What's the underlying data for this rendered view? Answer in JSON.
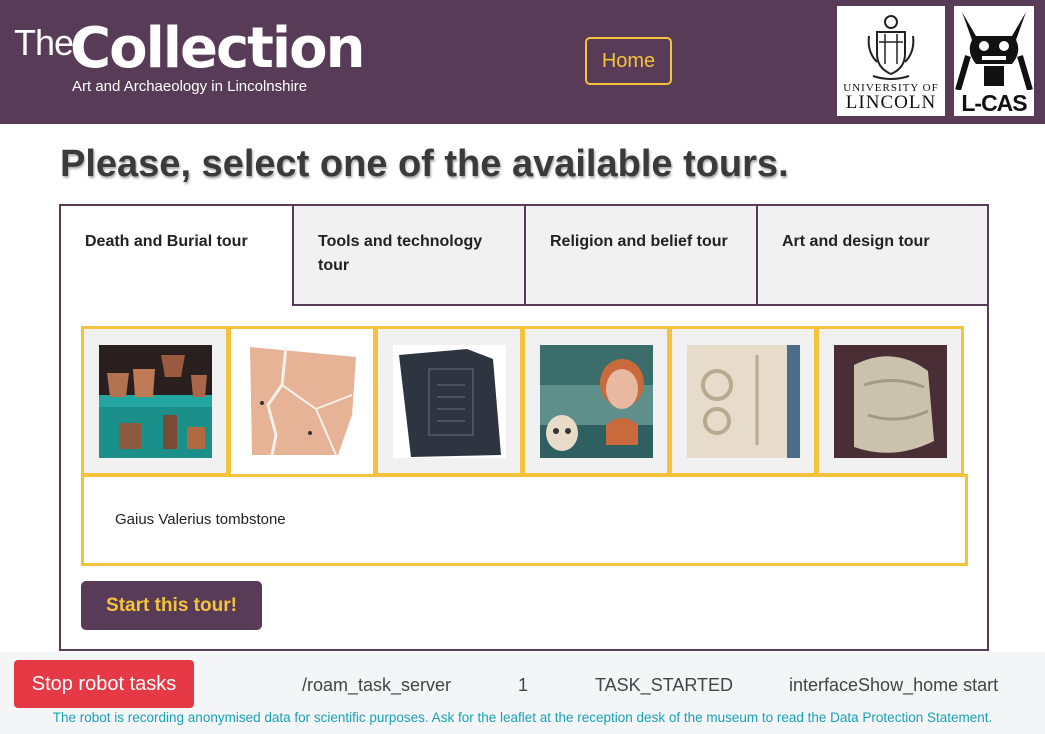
{
  "header": {
    "logo_the": "The",
    "logo_collection": "Collection",
    "logo_subtitle": "Art and Archaeology in Lincolnshire",
    "home_label": "Home",
    "university_line1": "UNIVERSITY OF",
    "university_line2": "LINCOLN",
    "lcas_label": "L-CAS"
  },
  "page": {
    "title": "Please, select one of the available tours."
  },
  "tabs": [
    {
      "label": "Death and Burial tour",
      "active": true
    },
    {
      "label": "Tools and technology tour",
      "active": false
    },
    {
      "label": "Religion and belief tour",
      "active": false
    },
    {
      "label": "Art and design tour",
      "active": false
    }
  ],
  "exhibits": [
    {
      "icon": "pottery-display-image",
      "selected": false
    },
    {
      "icon": "stone-fragment-image",
      "selected": true
    },
    {
      "icon": "dark-tombstone-image",
      "selected": false
    },
    {
      "icon": "facial-reconstruction-image",
      "selected": false
    },
    {
      "icon": "carved-stone-image",
      "selected": false
    },
    {
      "icon": "stone-sculpture-image",
      "selected": false
    }
  ],
  "selected_description": "Gaius Valerius tombstone",
  "start_label": "Start this tour!",
  "footer": {
    "stop_label": "Stop robot tasks",
    "server": "/roam_task_server",
    "count": "1",
    "task_status": "TASK_STARTED",
    "interface_status": "interfaceShow_home start",
    "notice": "The robot is recording anonymised data for scientific purposes. Ask for the leaflet at the reception desk of the museum to read the Data Protection Statement."
  },
  "colors": {
    "brand_purple": "#573b57",
    "accent_yellow": "#f5c33b",
    "stop_red": "#e63946",
    "notice_teal": "#17a2b8"
  }
}
